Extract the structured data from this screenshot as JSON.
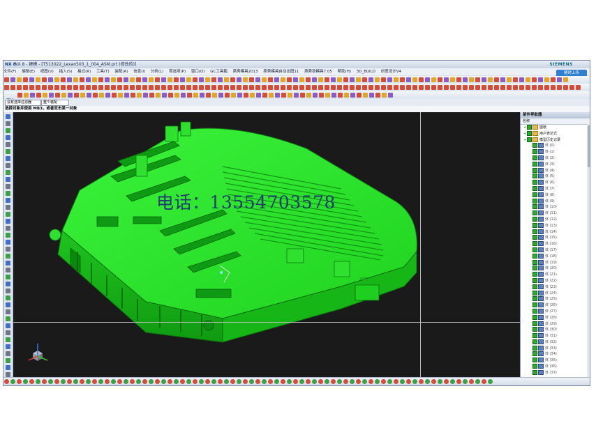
{
  "window": {
    "app_logo": "NX 8",
    "title": "NX 8 - 建模 - [T513022_Lexan503_1_004_ASM.prt (修改的)]",
    "brand": "SIEMENS"
  },
  "menu": [
    "文件(F)",
    "编辑(E)",
    "视图(V)",
    "插入(S)",
    "格式(R)",
    "工具(T)",
    "装配(A)",
    "信息(I)",
    "分析(L)",
    "首选项(P)",
    "窗口(O)",
    "GC工具箱",
    "燕秀模具2013",
    "燕秀模具自动出图11",
    "燕秀铁模具7.05",
    "帮助(H)",
    "3D_BUILD",
    "创意设计V4"
  ],
  "cloud_button": "随时上传",
  "filter_bar": {
    "selection_filter": "没有选择过滤器",
    "scope": "整个装配",
    "start_label": "开始"
  },
  "cue_line": "选择对象并使用 MB3，或者双击某一对象",
  "watermark": "电话：13554703578",
  "navigator": {
    "title": "部件导航器",
    "column_name": "名称",
    "nodes": [
      {
        "label": "图纸",
        "type": "fold"
      },
      {
        "label": "用户表达式",
        "type": "fold"
      },
      {
        "label": "模型历史记录",
        "type": "fold"
      }
    ],
    "features": [
      "体 (0)",
      "体 (1)",
      "体 (2)",
      "体 (3)",
      "体 (4)",
      "体 (5)",
      "体 (6)",
      "体 (7)",
      "体 (8)",
      "体 (9)",
      "体 (10)",
      "体 (11)",
      "体 (12)",
      "体 (13)",
      "体 (14)",
      "体 (15)",
      "体 (16)",
      "体 (17)",
      "体 (18)",
      "体 (19)",
      "体 (20)",
      "体 (21)",
      "体 (22)",
      "体 (23)",
      "体 (24)",
      "体 (25)",
      "体 (26)",
      "体 (27)",
      "体 (28)",
      "体 (29)",
      "体 (30)",
      "体 (31)",
      "体 (32)",
      "体 (33)",
      "体 (34)",
      "体 (35)",
      "体 (36)",
      "体 (37)"
    ]
  },
  "model": {
    "color": "#22e822",
    "edge_color": "#0c7a10",
    "background": "#1a1a1a"
  },
  "triad_axes": {
    "x": "X",
    "y": "Y",
    "z": "Z"
  }
}
